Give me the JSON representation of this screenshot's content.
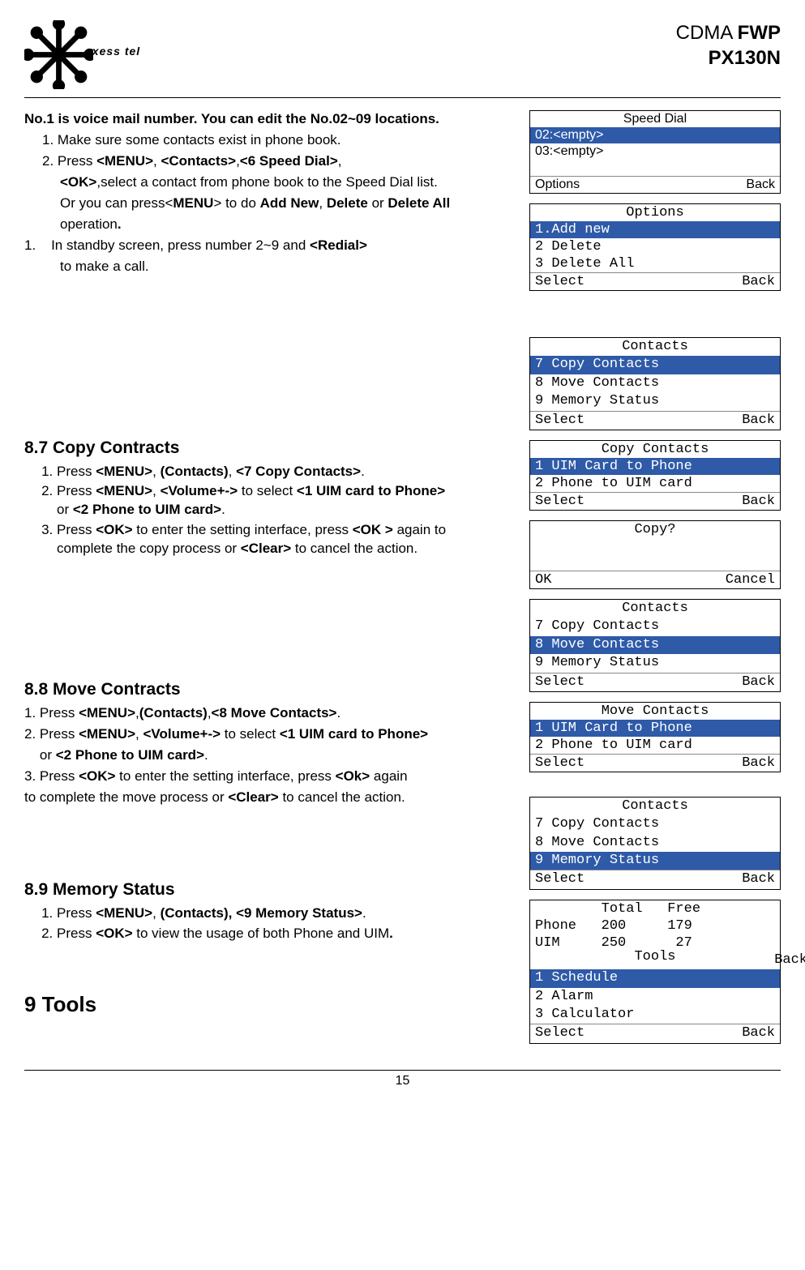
{
  "header": {
    "brand": "axess tel",
    "title_line1": "CDMA ",
    "title_line1_bold": "FWP",
    "title_line2": "PX130N"
  },
  "section_voicemail": {
    "heading": "No.1 is voice mail number. You can edit the No.02~09 locations.",
    "line1": "1. Make sure some contacts exist in phone book.",
    "line2_pre": "2.  Press  ",
    "line2_m1": "<MENU>",
    "line2_sep": ", ",
    "line2_m2": "<Contacts>",
    "line2_m3": "<6 Speed Dial>",
    "line2_post": ",",
    "line3_pre": "",
    "line3_b1": "<OK>",
    "line3_mid": ",select a contact from phone book to the Speed Dial list.",
    "line4_pre": "Or you can press<",
    "line4_b1": "MENU",
    "line4_mid1": "> to do ",
    "line4_b2": "Add New",
    "line4_mid2": ", ",
    "line4_b3": "Delete",
    "line4_mid3": " or ",
    "line4_b4": "Delete All",
    "line5_pre": "operation",
    "line5_dot": ".",
    "step1_pre": "In standby screen, press number 2~9 and ",
    "step1_b": "<Redial>",
    "step1_line2": "to make a call."
  },
  "section_87": {
    "heading": "8.7    Copy Contracts",
    "s1_pre": "Press ",
    "s1_b1": "<MENU>",
    "s1_mid1": ", ",
    "s1_b2": "(Contacts)",
    "s1_mid2": ", ",
    "s1_b3": "<7 Copy Contacts>",
    "s1_post": ".",
    "s2_pre": "Press ",
    "s2_b1": "<MENU>",
    "s2_mid1": ", ",
    "s2_b2": "<Volume+->",
    "s2_mid2": " to select ",
    "s2_b3": "<1 UIM card to Phone>",
    "s2_line2_pre": "or ",
    "s2_line2_b": "<2 Phone to UIM card>",
    "s2_line2_post": ".",
    "s3_pre": "Press ",
    "s3_b1": "<OK>",
    "s3_mid1": " to enter the setting interface, press ",
    "s3_b2": "<OK >",
    "s3_mid2": " again to",
    "s3_line2_pre": "complete the copy process or ",
    "s3_line2_b": "<Clear>",
    "s3_line2_post": " to cancel the action."
  },
  "section_88": {
    "heading": "8.8    Move Contracts",
    "l1_pre": "1. Press ",
    "l1_b1": "<MENU>",
    "l1_mid1": ",",
    "l1_b2": "(Contacts)",
    "l1_mid2": ",",
    "l1_b3": "<8 Move Contacts>",
    "l1_post": ".",
    "l2_pre": "2. Press ",
    "l2_b1": "<MENU>",
    "l2_mid1": ", ",
    "l2_b2": "<Volume+->",
    "l2_mid2": " to select ",
    "l2_b3": "<1 UIM card to Phone>",
    "l2b_pre": "    or ",
    "l2b_b": "<2 Phone to UIM card>",
    "l2b_post": ".",
    "l3_pre": "3. Press ",
    "l3_b1": "<OK>",
    "l3_mid1": " to enter the setting interface, press ",
    "l3_b2": "<Ok>",
    "l3_mid2": " again",
    "l3b_pre": " to complete the move process or ",
    "l3b_b": "<Clear>",
    "l3b_post": " to cancel the action."
  },
  "section_89": {
    "heading": "8.9    Memory Status",
    "s1_pre": "Press ",
    "s1_b1": "<MENU>",
    "s1_mid1": ", ",
    "s1_b2": "(Contacts), <9 Memory Status>",
    "s1_post": ".",
    "s2_pre": "Press ",
    "s2_b1": "<OK>",
    "s2_mid1": " to view the usage of  both Phone and UIM",
    "s2_dot": "."
  },
  "section_9": {
    "heading": "9    Tools"
  },
  "phone_speeddial": {
    "title": "Speed Dial",
    "row1": "02:<empty>",
    "row2": "03:<empty>",
    "left": "Options",
    "right": "Back"
  },
  "phone_options": {
    "title": "Options",
    "row1": "1.Add new",
    "row2": "2 Delete",
    "row3": "3 Delete All",
    "left": "Select",
    "right": "Back"
  },
  "phone_contacts1": {
    "title": "Contacts",
    "row1": "7 Copy Contacts",
    "row2": "8 Move Contacts",
    "row3": "9 Memory Status",
    "left": "Select",
    "right": "Back"
  },
  "phone_copycontacts": {
    "title": "Copy Contacts",
    "row1": "1 UIM Card to Phone",
    "row2": "2 Phone to UIM card",
    "left": "Select",
    "right": "Back"
  },
  "phone_copy": {
    "title": "Copy?",
    "left": "OK",
    "right": "Cancel"
  },
  "phone_contacts2": {
    "title": "Contacts",
    "row1": "7 Copy Contacts",
    "row2": "8 Move Contacts",
    "row3": "9 Memory Status",
    "left": "Select",
    "right": "Back"
  },
  "phone_movecontacts": {
    "title": "Move Contacts",
    "row1": "1 UIM Card to Phone",
    "row2": "2 Phone to UIM card",
    "left": "Select",
    "right": "Back"
  },
  "phone_contacts3": {
    "title": "Contacts",
    "row1": "7 Copy Contacts",
    "row2": "8 Move Contacts",
    "row3": "9 Memory Status",
    "left": "Select",
    "right": "Back"
  },
  "phone_memstatus": {
    "header": "        Total   Free",
    "row1": "Phone   200     179",
    "row2": "UIM     250      27",
    "right": "Back"
  },
  "phone_tools": {
    "title": "Tools",
    "row1": "1 Schedule",
    "row2": "2 Alarm",
    "row3": "3 Calculator",
    "left": "Select",
    "right": "Back"
  },
  "footer": {
    "page": "15"
  }
}
